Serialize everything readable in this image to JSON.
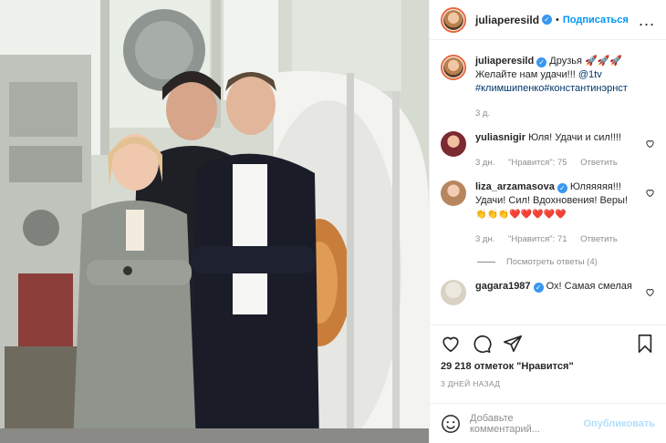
{
  "header": {
    "username": "juliaperesild",
    "separator": "•",
    "follow_label": "Подписаться",
    "more_label": "..."
  },
  "caption": {
    "username": "juliaperesild",
    "text_1": "Друзья",
    "text_2": "Желайте нам удачи!!! ",
    "mention": "@1tv",
    "hashtags": "#климшипенко#константинэрнст",
    "time": "3 д."
  },
  "comments": [
    {
      "username": "yuliasnigir",
      "text": "Юля! Удачи и сил!!!!",
      "time": "3 дн.",
      "likes": "\"Нравится\": 75",
      "reply": "Ответить"
    },
    {
      "username": "liza_arzamasova",
      "text": "Юляяяяя!!! Удачи! Сил! Вдохновения! Веры!",
      "time": "3 дн.",
      "likes": "\"Нравится\": 71",
      "reply": "Ответить",
      "view_replies": "Посмотреть ответы (4)"
    },
    {
      "username": "gagara1987",
      "text": "Ох! Самая смелая",
      "time": "",
      "likes": "",
      "reply": ""
    }
  ],
  "likes_count": "29 218 отметок \"Нравится\"",
  "post_date": "3 ДНЕЙ НАЗАД",
  "add_comment": {
    "placeholder": "Добавьте комментарий...",
    "publish_label": "Опубликовать"
  },
  "colors": {
    "accent": "#0095f6",
    "verified": "#3897f0",
    "muted": "#8e8e8e"
  }
}
